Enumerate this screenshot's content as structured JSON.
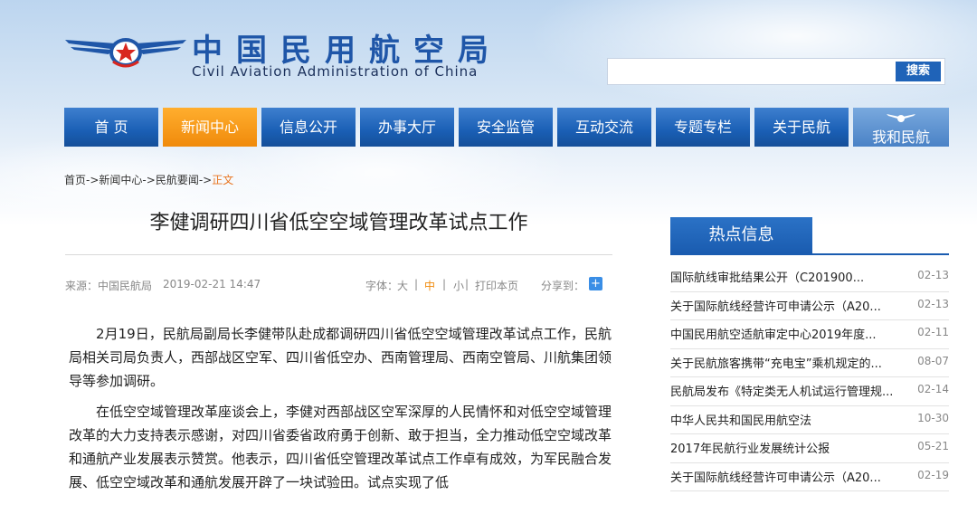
{
  "header": {
    "site_name_cn": "中国民用航空局",
    "site_name_en": "Civil Aviation Administration of China",
    "search_placeholder": "",
    "search_label": "搜索"
  },
  "nav": [
    {
      "label": "首 页"
    },
    {
      "label": "新闻中心",
      "active": true
    },
    {
      "label": "信息公开"
    },
    {
      "label": "办事大厅"
    },
    {
      "label": "安全监管"
    },
    {
      "label": "互动交流"
    },
    {
      "label": "专题专栏"
    },
    {
      "label": "关于民航"
    },
    {
      "label": "我和民航"
    }
  ],
  "breadcrumb": {
    "home": "首页",
    "sep": "->",
    "level1": "新闻中心",
    "level2": "民航要闻",
    "current": "正文"
  },
  "article": {
    "title": "李健调研四川省低空空域管理改革试点工作",
    "source": "来源：中国民航局",
    "date": "2019-02-21 14:47",
    "font_label": "字体：",
    "font_large": "大",
    "font_medium": "中",
    "font_small": "小",
    "divider": "|",
    "print_label": "打印本页",
    "share_label": "分享到：",
    "paragraphs": [
      "2月19日，民航局副局长李健带队赴成都调研四川省低空空域管理改革试点工作，民航局相关司局负责人，西部战区空军、四川省低空办、西南管理局、西南空管局、川航集团领导等参加调研。",
      "在低空空域管理改革座谈会上，李健对西部战区空军深厚的人民情怀和对低空空域管理改革的大力支持表示感谢，对四川省委省政府勇于创新、敢于担当，全力推动低空空域改革和通航产业发展表示赞赏。他表示，四川省低空管理改革试点工作卓有成效，为军民融合发展、低空空域改革和通航发展开辟了一块试验田。试点实现了低"
    ]
  },
  "sidebar": {
    "heading": "热点信息",
    "items": [
      {
        "title": "国际航线审批结果公开（C201900...",
        "date": "02-13"
      },
      {
        "title": "关于国际航线经营许可申请公示（A20...",
        "date": "02-13"
      },
      {
        "title": "中国民用航空适航审定中心2019年度...",
        "date": "02-11"
      },
      {
        "title": "关于民航旅客携带“充电宝”乘机规定的...",
        "date": "08-07"
      },
      {
        "title": "民航局发布《特定类无人机试运行管理规...",
        "date": "02-14"
      },
      {
        "title": "中华人民共和国民用航空法",
        "date": "10-30"
      },
      {
        "title": "2017年民航行业发展统计公报",
        "date": "05-21"
      },
      {
        "title": "关于国际航线经营许可申请公示（A20...",
        "date": "02-19"
      }
    ]
  },
  "colors": {
    "brand_blue": "#1f56a8",
    "nav_active": "#f08a0b",
    "accent_orange": "#e8741e"
  }
}
